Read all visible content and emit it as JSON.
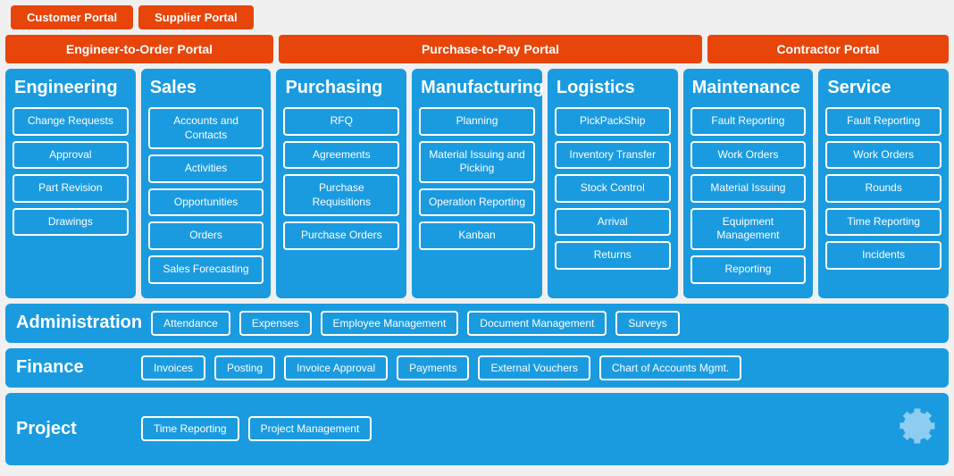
{
  "topPortals": [
    {
      "label": "Customer Portal"
    },
    {
      "label": "Supplier Portal"
    }
  ],
  "portalHeaders": [
    {
      "label": "Engineer-to-Order Portal",
      "cls": "portal-header-engineer"
    },
    {
      "label": "Purchase-to-Pay Portal",
      "cls": "portal-header-purchase"
    },
    {
      "label": "Contractor Portal",
      "cls": "portal-header-contractor"
    }
  ],
  "columns": [
    {
      "title": "Engineering",
      "items": [
        "Change Requests",
        "Approval",
        "Part Revision",
        "Drawings"
      ]
    },
    {
      "title": "Sales",
      "items": [
        "Accounts and Contacts",
        "Activities",
        "Opportunities",
        "Orders",
        "Sales Forecasting"
      ]
    },
    {
      "title": "Purchasing",
      "items": [
        "RFQ",
        "Agreements",
        "Purchase Requisitions",
        "Purchase Orders"
      ]
    },
    {
      "title": "Manufacturing",
      "items": [
        "Planning",
        "Material Issuing and Picking",
        "Operation Reporting",
        "Kanban"
      ]
    },
    {
      "title": "Logistics",
      "items": [
        "PickPackShip",
        "Inventory Transfer",
        "Stock Control",
        "Arrival",
        "Returns"
      ]
    },
    {
      "title": "Maintenance",
      "items": [
        "Fault Reporting",
        "Work Orders",
        "Material Issuing",
        "Equipment Management",
        "Reporting"
      ]
    },
    {
      "title": "Service",
      "items": [
        "Fault Reporting",
        "Work Orders",
        "Rounds",
        "Time Reporting",
        "Incidents"
      ]
    }
  ],
  "bottomRows": [
    {
      "title": "Administration",
      "items": [
        "Attendance",
        "Expenses",
        "Employee Management",
        "Document Management",
        "Surveys"
      ]
    },
    {
      "title": "Finance",
      "items": [
        "Invoices",
        "Posting",
        "Invoice Approval",
        "Payments",
        "External Vouchers",
        "Chart of Accounts Mgmt."
      ]
    },
    {
      "title": "Project",
      "items": [
        "Time Reporting",
        "Project Management"
      ]
    }
  ]
}
